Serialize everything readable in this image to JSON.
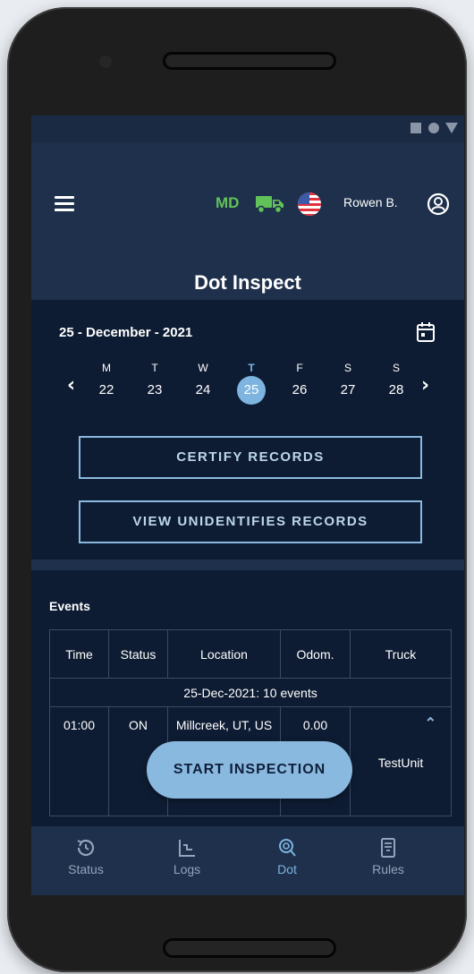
{
  "header": {
    "region_code": "MD",
    "user_name": "Rowen B.",
    "title": "Dot Inspect"
  },
  "date_selector": {
    "current_date": "25 - December - 2021",
    "days": [
      {
        "letter": "M",
        "number": "22"
      },
      {
        "letter": "T",
        "number": "23"
      },
      {
        "letter": "W",
        "number": "24"
      },
      {
        "letter": "T",
        "number": "25"
      },
      {
        "letter": "F",
        "number": "26"
      },
      {
        "letter": "S",
        "number": "27"
      },
      {
        "letter": "S",
        "number": "28"
      }
    ],
    "selected_index": 3
  },
  "buttons": {
    "certify": "CERTIFY RECORDS",
    "view_unidentified": "VIEW UNIDENTIFIES RECORDS",
    "start_inspection": "START INSPECTION"
  },
  "events": {
    "title": "Events",
    "columns": [
      "Time",
      "Status",
      "Location",
      "Odom.",
      "Truck"
    ],
    "summary": "25-Dec-2021: 10 events",
    "rows": [
      {
        "time": "01:00",
        "status": "ON",
        "location": "Millcreek, UT, US",
        "odometer": "0.00",
        "truck": "TestUnit"
      }
    ]
  },
  "nav": {
    "items": [
      {
        "label": "Status",
        "icon": "history-icon"
      },
      {
        "label": "Logs",
        "icon": "logs-chart-icon"
      },
      {
        "label": "Dot",
        "icon": "dot-search-icon"
      },
      {
        "label": "Rules",
        "icon": "rules-doc-icon"
      }
    ],
    "active": "Dot"
  },
  "colors": {
    "accent": "#7db5e0",
    "background": "#0e1c33",
    "header": "#1e304b",
    "region_code": "#62c25a"
  }
}
